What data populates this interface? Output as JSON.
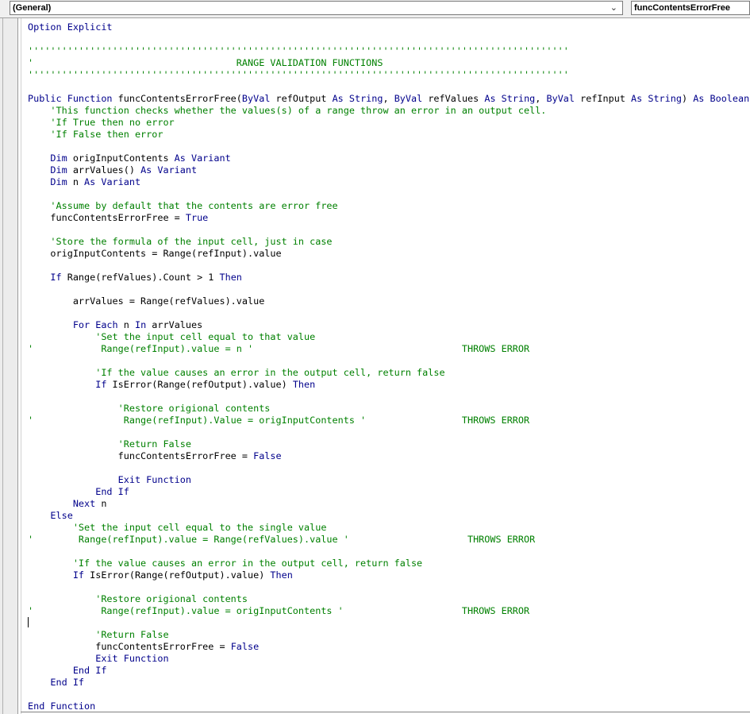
{
  "header": {
    "object_combo": "(General)",
    "procedure_combo": "funcContentsErrorFree"
  },
  "code_lines": [
    [
      {
        "t": "kw",
        "v": "Option Explicit"
      }
    ],
    [],
    [
      {
        "t": "cm",
        "v": "''''''''''''''''''''''''''''''''''''''''''''''''''''''''''''''''''''''''''''''''''''''''''''''''"
      }
    ],
    [
      {
        "t": "cm",
        "v": "'                                    RANGE VALIDATION FUNCTIONS"
      }
    ],
    [
      {
        "t": "cm",
        "v": "''''''''''''''''''''''''''''''''''''''''''''''''''''''''''''''''''''''''''''''''''''''''''''''''"
      }
    ],
    [],
    [
      {
        "t": "kw",
        "v": "Public Function "
      },
      {
        "t": "pl",
        "v": "funcContentsErrorFree("
      },
      {
        "t": "kw",
        "v": "ByVal "
      },
      {
        "t": "pl",
        "v": "refOutput "
      },
      {
        "t": "kw",
        "v": "As String"
      },
      {
        "t": "pl",
        "v": ", "
      },
      {
        "t": "kw",
        "v": "ByVal "
      },
      {
        "t": "pl",
        "v": "refValues "
      },
      {
        "t": "kw",
        "v": "As String"
      },
      {
        "t": "pl",
        "v": ", "
      },
      {
        "t": "kw",
        "v": "ByVal "
      },
      {
        "t": "pl",
        "v": "refInput "
      },
      {
        "t": "kw",
        "v": "As String"
      },
      {
        "t": "pl",
        "v": ") "
      },
      {
        "t": "kw",
        "v": "As Boolean"
      }
    ],
    [
      {
        "t": "cm",
        "v": "    'This function checks whether the values(s) of a range throw an error in an output cell."
      }
    ],
    [
      {
        "t": "cm",
        "v": "    'If True then no error"
      }
    ],
    [
      {
        "t": "cm",
        "v": "    'If False then error"
      }
    ],
    [],
    [
      {
        "t": "kw",
        "v": "    Dim "
      },
      {
        "t": "pl",
        "v": "origInputContents "
      },
      {
        "t": "kw",
        "v": "As Variant"
      }
    ],
    [
      {
        "t": "kw",
        "v": "    Dim "
      },
      {
        "t": "pl",
        "v": "arrValues() "
      },
      {
        "t": "kw",
        "v": "As Variant"
      }
    ],
    [
      {
        "t": "kw",
        "v": "    Dim "
      },
      {
        "t": "pl",
        "v": "n "
      },
      {
        "t": "kw",
        "v": "As Variant"
      }
    ],
    [],
    [
      {
        "t": "cm",
        "v": "    'Assume by default that the contents are error free"
      }
    ],
    [
      {
        "t": "pl",
        "v": "    funcContentsErrorFree = "
      },
      {
        "t": "kw",
        "v": "True"
      }
    ],
    [],
    [
      {
        "t": "cm",
        "v": "    'Store the formula of the input cell, just in case"
      }
    ],
    [
      {
        "t": "pl",
        "v": "    origInputContents = Range(refInput).value"
      }
    ],
    [],
    [
      {
        "t": "kw",
        "v": "    If "
      },
      {
        "t": "pl",
        "v": "Range(refValues).Count > 1 "
      },
      {
        "t": "kw",
        "v": "Then"
      }
    ],
    [],
    [
      {
        "t": "pl",
        "v": "        arrValues = Range(refValues).value"
      }
    ],
    [],
    [
      {
        "t": "kw",
        "v": "        For Each "
      },
      {
        "t": "pl",
        "v": "n "
      },
      {
        "t": "kw",
        "v": "In "
      },
      {
        "t": "pl",
        "v": "arrValues"
      }
    ],
    [
      {
        "t": "cm",
        "v": "            'Set the input cell equal to that value"
      }
    ],
    [
      {
        "t": "cm",
        "v": "'            Range(refInput).value = n '                                     THROWS ERROR"
      }
    ],
    [],
    [
      {
        "t": "cm",
        "v": "            'If the value causes an error in the output cell, return false"
      }
    ],
    [
      {
        "t": "kw",
        "v": "            If "
      },
      {
        "t": "pl",
        "v": "IsError(Range(refOutput).value) "
      },
      {
        "t": "kw",
        "v": "Then"
      }
    ],
    [],
    [
      {
        "t": "cm",
        "v": "                'Restore origional contents"
      }
    ],
    [
      {
        "t": "cm",
        "v": "'                Range(refInput).Value = origInputContents '                 THROWS ERROR"
      }
    ],
    [],
    [
      {
        "t": "cm",
        "v": "                'Return False"
      }
    ],
    [
      {
        "t": "pl",
        "v": "                funcContentsErrorFree = "
      },
      {
        "t": "kw",
        "v": "False"
      }
    ],
    [],
    [
      {
        "t": "kw",
        "v": "                Exit Function"
      }
    ],
    [
      {
        "t": "kw",
        "v": "            End If"
      }
    ],
    [
      {
        "t": "kw",
        "v": "        Next "
      },
      {
        "t": "pl",
        "v": "n"
      }
    ],
    [
      {
        "t": "kw",
        "v": "    Else"
      }
    ],
    [
      {
        "t": "cm",
        "v": "        'Set the input cell equal to the single value"
      }
    ],
    [
      {
        "t": "cm",
        "v": "'        Range(refInput).value = Range(refValues).value '                     THROWS ERROR"
      }
    ],
    [],
    [
      {
        "t": "cm",
        "v": "        'If the value causes an error in the output cell, return false"
      }
    ],
    [
      {
        "t": "kw",
        "v": "        If "
      },
      {
        "t": "pl",
        "v": "IsError(Range(refOutput).value) "
      },
      {
        "t": "kw",
        "v": "Then"
      }
    ],
    [],
    [
      {
        "t": "cm",
        "v": "            'Restore origional contents"
      }
    ],
    [
      {
        "t": "cm",
        "v": "'            Range(refInput).value = origInputContents '                     THROWS ERROR"
      }
    ],
    [],
    [
      {
        "t": "cm",
        "v": "            'Return False"
      }
    ],
    [
      {
        "t": "pl",
        "v": "            funcContentsErrorFree = "
      },
      {
        "t": "kw",
        "v": "False"
      }
    ],
    [
      {
        "t": "kw",
        "v": "            Exit Function"
      }
    ],
    [
      {
        "t": "kw",
        "v": "        End If"
      }
    ],
    [
      {
        "t": "kw",
        "v": "    End If"
      }
    ],
    [],
    [
      {
        "t": "kw",
        "v": "End Function"
      }
    ]
  ],
  "colors": {
    "keyword": "#00008b",
    "comment": "#008000",
    "plain": "#000000"
  }
}
